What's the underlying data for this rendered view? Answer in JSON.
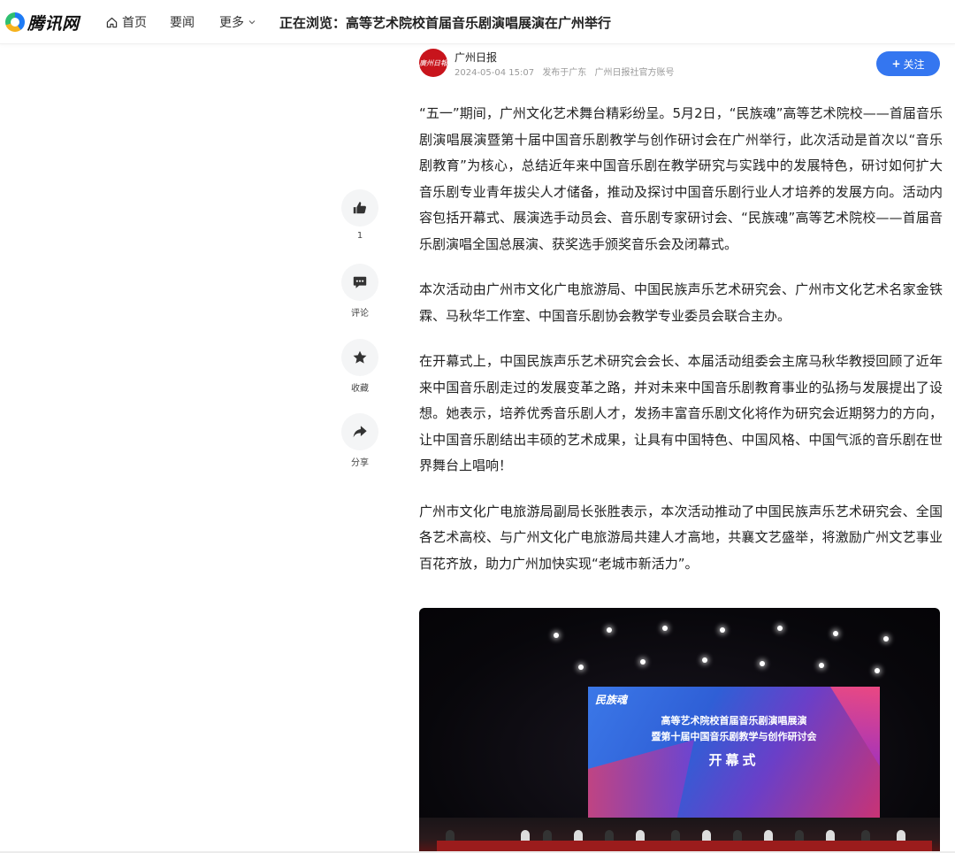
{
  "header": {
    "logo_text": "腾讯网",
    "nav": [
      {
        "label": "首页"
      },
      {
        "label": "要闻"
      },
      {
        "label": "更多"
      }
    ],
    "now_reading": "正在浏览：高等艺术院校首届音乐剧演唱展演在广州举行"
  },
  "author": {
    "avatar_text": "廣州日報",
    "name": "广州日报",
    "date": "2024-05-04 15:07",
    "location": "发布于广东",
    "account": "广州日报社官方账号",
    "follow_label": "关注"
  },
  "actions": {
    "like": {
      "label": "1",
      "icon": "thumb-up-icon"
    },
    "comment": {
      "label": "评论",
      "icon": "comment-icon"
    },
    "favorite": {
      "label": "收藏",
      "icon": "star-icon"
    },
    "share": {
      "label": "分享",
      "icon": "share-icon"
    }
  },
  "article": {
    "paragraphs": [
      "“五一”期间，广州文化艺术舞台精彩纷呈。5月2日，“民族魂”高等艺术院校——首届音乐剧演唱展演暨第十届中国音乐剧教学与创作研讨会在广州举行，此次活动是首次以“音乐剧教育”为核心，总结近年来中国音乐剧在教学研究与实践中的发展特色，研讨如何扩大音乐剧专业青年拔尖人才储备，推动及探讨中国音乐剧行业人才培养的发展方向。活动内容包括开幕式、展演选手动员会、音乐剧专家研讨会、“民族魂”高等艺术院校——首届音乐剧演唱全国总展演、获奖选手颁奖音乐会及闭幕式。",
      "本次活动由广州市文化广电旅游局、中国民族声乐艺术研究会、广州市文化艺术名家金铁霖、马秋华工作室、中国音乐剧协会教学专业委员会联合主办。",
      "在开幕式上，中国民族声乐艺术研究会会长、本届活动组委会主席马秋华教授回顾了近年来中国音乐剧走过的发展变革之路，并对未来中国音乐剧教育事业的弘扬与发展提出了设想。她表示，培养优秀音乐剧人才，发扬丰富音乐剧文化将作为研究会近期努力的方向，让中国音乐剧结出丰硕的艺术成果，让具有中国特色、中国风格、中国气派的音乐剧在世界舞台上唱响！",
      "广州市文化广电旅游局副局长张胜表示，本次活动推动了中国民族声乐艺术研究会、全国各艺术高校、与广州文化广电旅游局共建人才高地，共襄文艺盛举，将激励广州文艺事业百花齐放，助力广州加快实现“老城市新活力”。"
    ]
  },
  "photo": {
    "screen_brand": "民族魂",
    "screen_line1": "高等艺术院校首届音乐剧演唱展演",
    "screen_line2": "暨第十届中国音乐剧教学与创作研讨会",
    "screen_line3": "开幕式"
  }
}
